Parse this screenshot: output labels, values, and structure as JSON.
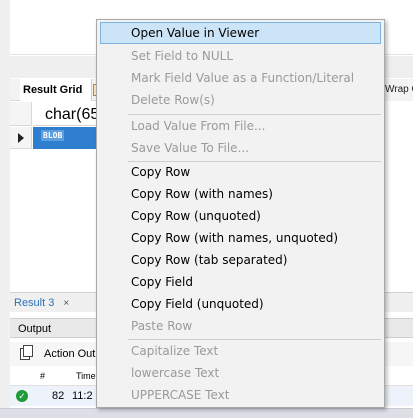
{
  "grid": {
    "tab_label": "Result Grid",
    "wrap_label": "Wrap C",
    "column_header": "char(65",
    "cell_value": "BLOB"
  },
  "result_tabs": {
    "active_label": "Result 3",
    "close_glyph": "×"
  },
  "output": {
    "title": "Output",
    "dropdown_label": "Action Outp",
    "columns": {
      "hash": "#",
      "time": "Time"
    },
    "row": {
      "number": "82",
      "time": "11:2"
    }
  },
  "context_menu": {
    "highlight_color": "#cce4f7",
    "items": [
      {
        "label": "Open Value in Viewer",
        "enabled": true,
        "highlighted": true
      },
      {
        "label": "Set Field to NULL",
        "enabled": false
      },
      {
        "label": "Mark Field Value as a Function/Literal",
        "enabled": false
      },
      {
        "label": "Delete Row(s)",
        "enabled": false
      },
      {
        "label": "Load Value From File...",
        "enabled": false
      },
      {
        "label": "Save Value To File...",
        "enabled": false
      },
      {
        "label": "Copy Row",
        "enabled": true
      },
      {
        "label": "Copy Row (with names)",
        "enabled": true
      },
      {
        "label": "Copy Row (unquoted)",
        "enabled": true
      },
      {
        "label": "Copy Row (with names, unquoted)",
        "enabled": true
      },
      {
        "label": "Copy Row (tab separated)",
        "enabled": true
      },
      {
        "label": "Copy Field",
        "enabled": true
      },
      {
        "label": "Copy Field (unquoted)",
        "enabled": true
      },
      {
        "label": "Paste Row",
        "enabled": false
      },
      {
        "label": "Capitalize Text",
        "enabled": false
      },
      {
        "label": "lowercase Text",
        "enabled": false
      },
      {
        "label": "UPPERCASE Text",
        "enabled": false
      }
    ]
  }
}
